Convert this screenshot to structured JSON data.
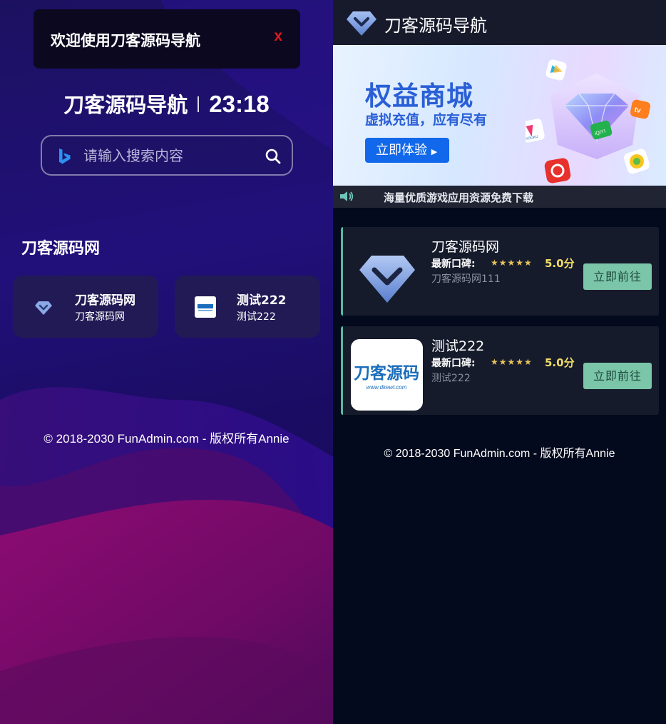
{
  "left": {
    "notice": {
      "text": "欢迎使用刀客源码导航",
      "close_label": "x"
    },
    "brand": {
      "name": "刀客源码导航",
      "time": "23:18"
    },
    "search": {
      "placeholder": "请输入搜索内容",
      "engine_icon": "bing-icon"
    },
    "group": {
      "title": "刀客源码网",
      "sites": [
        {
          "name": "刀客源码网",
          "desc": "刀客源码网"
        },
        {
          "name": "测试222",
          "desc": "测试222"
        }
      ]
    },
    "footer": "© 2018-2030 FunAdmin.com - 版权所有Annie"
  },
  "right": {
    "header": {
      "title": "刀客源码导航"
    },
    "banner": {
      "title": "权益商城",
      "subtitle": "虚拟充值，应有尽有",
      "button": "立即体验",
      "app_icon_labels": [
        "iQIYI",
        "YOUKU"
      ]
    },
    "notice": "海量优质游戏应用资源免费下载",
    "apps": [
      {
        "name": "刀客源码网",
        "rating_label": "最新口碑:",
        "stars": "★★★★★",
        "score": "5.0分",
        "desc": "刀客源码网111",
        "button": "立即前往"
      },
      {
        "name": "测试222",
        "rating_label": "最新口碑:",
        "stars": "★★★★★",
        "score": "5.0分",
        "desc": "测试222",
        "button": "立即前往"
      }
    ],
    "logo_text": {
      "main": "刀客源码",
      "sub": "www.dkewl.com"
    },
    "footer": "© 2018-2030 FunAdmin.com - 版权所有Annie"
  },
  "colors": {
    "left_bg": "#1b1160",
    "wave_magenta": "#8a0a6e",
    "card_accent": "#58b9a3",
    "button_green": "#7bc6a9",
    "close_red": "#e01818",
    "banner_blue": "#2a5fd6"
  }
}
